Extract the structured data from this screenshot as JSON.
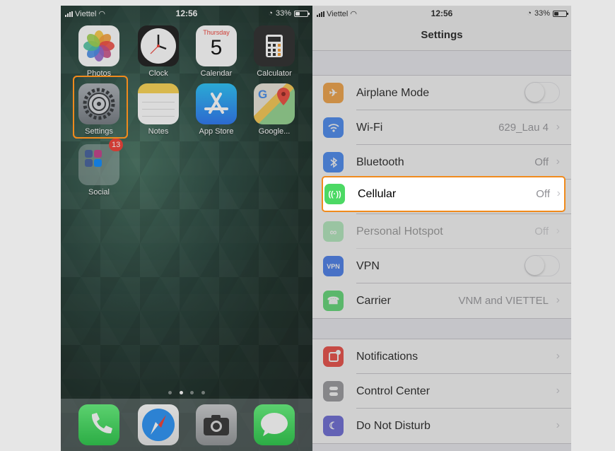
{
  "home": {
    "status": {
      "carrier": "Viettel",
      "time": "12:56",
      "battery": "33%"
    },
    "apps": [
      {
        "label": "Photos",
        "icon": "photos-icon"
      },
      {
        "label": "Clock",
        "icon": "clock-icon"
      },
      {
        "label": "Calendar",
        "icon": "calendar-icon",
        "weekday": "Thursday",
        "day": "5"
      },
      {
        "label": "Calculator",
        "icon": "calculator-icon"
      },
      {
        "label": "Settings",
        "icon": "settings-gear-icon"
      },
      {
        "label": "Notes",
        "icon": "notes-icon"
      },
      {
        "label": "App Store",
        "icon": "app-store-icon"
      },
      {
        "label": "Google...",
        "icon": "google-maps-icon"
      },
      {
        "label": "Social",
        "icon": "social-folder-icon",
        "badge": "13"
      }
    ],
    "dock": [
      {
        "icon": "phone-icon"
      },
      {
        "icon": "safari-icon"
      },
      {
        "icon": "camera-icon"
      },
      {
        "icon": "messages-icon"
      }
    ],
    "page_count": 4,
    "current_page": 2
  },
  "settings": {
    "status": {
      "carrier": "Viettel",
      "time": "12:56",
      "battery": "33%"
    },
    "title": "Settings",
    "rows": [
      {
        "label": "Airplane Mode",
        "value": "",
        "icon": "airplane-icon",
        "color": "#f79a2c",
        "toggle": true
      },
      {
        "label": "Wi-Fi",
        "value": "629_Lau 4",
        "icon": "wifi-icon",
        "color": "#2f7cf6"
      },
      {
        "label": "Bluetooth",
        "value": "Off",
        "icon": "bluetooth-icon",
        "color": "#2f7cf6"
      },
      {
        "label": "Cellular",
        "value": "Off",
        "icon": "cellular-antenna-icon",
        "color": "#4cd964"
      },
      {
        "label": "Personal Hotspot",
        "value": "Off",
        "icon": "hotspot-icon",
        "color": "#4cd964"
      },
      {
        "label": "VPN",
        "value": "",
        "icon": "vpn-icon",
        "color": "#2f6ef0",
        "toggle": true
      },
      {
        "label": "Carrier",
        "value": "VNM and VIETTEL",
        "icon": "carrier-phone-icon",
        "color": "#4cd964"
      }
    ],
    "rows2": [
      {
        "label": "Notifications",
        "icon": "notifications-icon",
        "color": "#f0342a"
      },
      {
        "label": "Control Center",
        "icon": "control-center-icon",
        "color": "#8e8e93"
      },
      {
        "label": "Do Not Disturb",
        "icon": "moon-icon",
        "color": "#5856d6"
      }
    ]
  }
}
